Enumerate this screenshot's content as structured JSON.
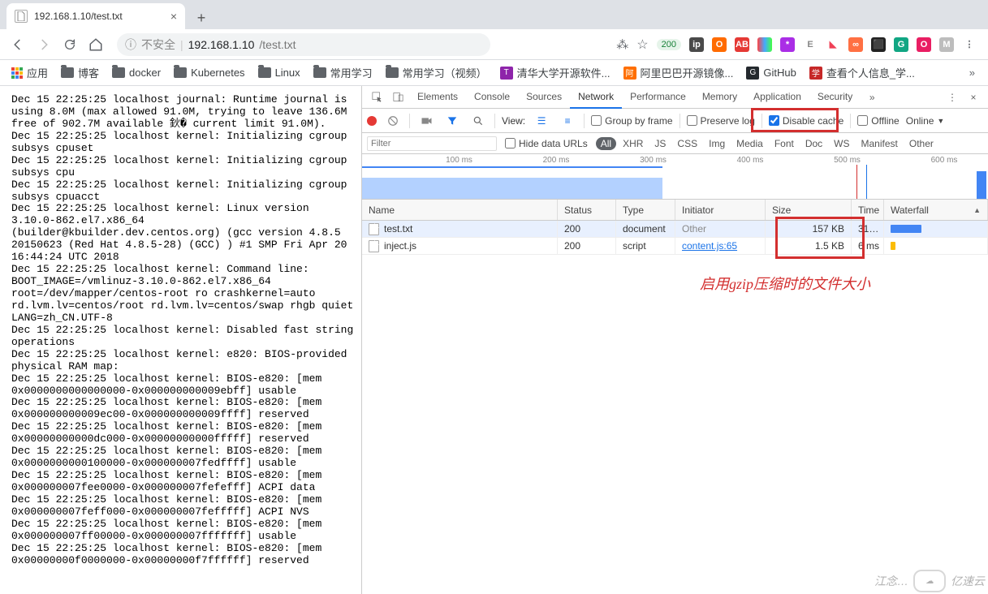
{
  "tab": {
    "title": "192.168.1.10/test.txt"
  },
  "addressbar": {
    "insecure_label": "不安全",
    "host": "192.168.1.10",
    "path": "/test.txt",
    "badge": "200"
  },
  "ext_icons": [
    {
      "name": "translate-icon",
      "bg": "#fff",
      "txt": "文",
      "fg": "#5f6368"
    },
    {
      "name": "star-icon",
      "bg": "#fff",
      "txt": "☆",
      "fg": "#5f6368"
    },
    {
      "name": "ip-icon",
      "bg": "#4a4a4a",
      "txt": "ip"
    },
    {
      "name": "opera-icon",
      "bg": "#ff6b00",
      "txt": "O"
    },
    {
      "name": "adblock-icon",
      "bg": "#e53935",
      "txt": "AB"
    },
    {
      "name": "rainbow-icon",
      "bg": "linear-gradient(90deg,#f44,#4af,#4f4)",
      "txt": ""
    },
    {
      "name": "lastpass-icon",
      "bg": "#aa2ee6",
      "txt": "*"
    },
    {
      "name": "evernote-icon",
      "bg": "#fff",
      "txt": "E",
      "fg": "#888"
    },
    {
      "name": "pocket-icon",
      "bg": "#fff",
      "txt": "◣",
      "fg": "#ef4056"
    },
    {
      "name": "infinity-icon",
      "bg": "#ff7043",
      "txt": "∞"
    },
    {
      "name": "dark-icon",
      "bg": "#222",
      "txt": "⬛"
    },
    {
      "name": "grammarly-icon",
      "bg": "#11a683",
      "txt": "G"
    },
    {
      "name": "onenote-icon",
      "bg": "#e91e63",
      "txt": "O"
    },
    {
      "name": "gray-icon",
      "bg": "#bdbdbd",
      "txt": "M"
    },
    {
      "name": "menu-icon",
      "bg": "#fff",
      "txt": "⋮",
      "fg": "#5f6368"
    }
  ],
  "bookmarks": {
    "apps": "应用",
    "items": [
      {
        "label": "博客",
        "type": "folder"
      },
      {
        "label": "docker",
        "type": "folder"
      },
      {
        "label": "Kubernetes",
        "type": "folder"
      },
      {
        "label": "Linux",
        "type": "folder"
      },
      {
        "label": "常用学习",
        "type": "folder"
      },
      {
        "label": "常用学习（视频）",
        "type": "folder"
      },
      {
        "label": "清华大学开源软件...",
        "type": "fav",
        "bg": "#8e24aa",
        "txt": "T"
      },
      {
        "label": "阿里巴巴开源镜像...",
        "type": "fav",
        "bg": "#ff6f00",
        "txt": "阿"
      },
      {
        "label": "GitHub",
        "type": "fav",
        "bg": "#24292e",
        "txt": "G"
      },
      {
        "label": "查看个人信息_学...",
        "type": "fav",
        "bg": "#c62828",
        "txt": "学"
      }
    ]
  },
  "page_text": "Dec 15 22:25:25 localhost journal: Runtime journal is using 8.0M (max allowed 91.0M, trying to leave 136.6M free of 902.7M available 鈥� current limit 91.0M).\nDec 15 22:25:25 localhost kernel: Initializing cgroup subsys cpuset\nDec 15 22:25:25 localhost kernel: Initializing cgroup subsys cpu\nDec 15 22:25:25 localhost kernel: Initializing cgroup subsys cpuacct\nDec 15 22:25:25 localhost kernel: Linux version 3.10.0-862.el7.x86_64 (builder@kbuilder.dev.centos.org) (gcc version 4.8.5 20150623 (Red Hat 4.8.5-28) (GCC) ) #1 SMP Fri Apr 20 16:44:24 UTC 2018\nDec 15 22:25:25 localhost kernel: Command line: BOOT_IMAGE=/vmlinuz-3.10.0-862.el7.x86_64 root=/dev/mapper/centos-root ro crashkernel=auto rd.lvm.lv=centos/root rd.lvm.lv=centos/swap rhgb quiet LANG=zh_CN.UTF-8\nDec 15 22:25:25 localhost kernel: Disabled fast string operations\nDec 15 22:25:25 localhost kernel: e820: BIOS-provided physical RAM map:\nDec 15 22:25:25 localhost kernel: BIOS-e820: [mem 0x0000000000000000-0x000000000009ebff] usable\nDec 15 22:25:25 localhost kernel: BIOS-e820: [mem 0x000000000009ec00-0x000000000009ffff] reserved\nDec 15 22:25:25 localhost kernel: BIOS-e820: [mem 0x00000000000dc000-0x00000000000fffff] reserved\nDec 15 22:25:25 localhost kernel: BIOS-e820: [mem 0x0000000000100000-0x000000007fedffff] usable\nDec 15 22:25:25 localhost kernel: BIOS-e820: [mem 0x000000007fee0000-0x000000007fefefff] ACPI data\nDec 15 22:25:25 localhost kernel: BIOS-e820: [mem 0x000000007feff000-0x000000007fefffff] ACPI NVS\nDec 15 22:25:25 localhost kernel: BIOS-e820: [mem 0x000000007ff00000-0x000000007fffffff] usable\nDec 15 22:25:25 localhost kernel: BIOS-e820: [mem 0x00000000f0000000-0x00000000f7ffffff] reserved",
  "devtools": {
    "tabs": [
      "Elements",
      "Console",
      "Sources",
      "Network",
      "Performance",
      "Memory",
      "Application",
      "Security"
    ],
    "active_tab": "Network",
    "toolbar": {
      "view_label": "View:",
      "group_by_frame": "Group by frame",
      "preserve_log": "Preserve log",
      "disable_cache": "Disable cache",
      "disable_cache_checked": true,
      "offline": "Offline",
      "online": "Online"
    },
    "filters": {
      "placeholder": "Filter",
      "hide_data_urls": "Hide data URLs",
      "types": [
        "All",
        "XHR",
        "JS",
        "CSS",
        "Img",
        "Media",
        "Font",
        "Doc",
        "WS",
        "Manifest",
        "Other"
      ],
      "active_type": "All"
    },
    "timeline_ticks": [
      "100 ms",
      "200 ms",
      "300 ms",
      "400 ms",
      "500 ms",
      "600 ms"
    ],
    "columns": [
      "Name",
      "Status",
      "Type",
      "Initiator",
      "Size",
      "Time",
      "Waterfall"
    ],
    "rows": [
      {
        "name": "test.txt",
        "status": "200",
        "type": "document",
        "initiator": "Other",
        "initiator_dim": true,
        "size": "157 KB",
        "time": "31…",
        "selected": true,
        "wf_color": "#4285f4",
        "wf_w": 38,
        "wf_x": 0
      },
      {
        "name": "inject.js",
        "status": "200",
        "type": "script",
        "initiator": "content.js:65",
        "initiator_dim": false,
        "size": "1.5 KB",
        "time": "6 ms",
        "selected": false,
        "wf_color": "#fbbc04",
        "wf_w": 6,
        "wf_x": 0
      }
    ]
  },
  "annotation_text": "启用gzip压缩时的文件大小",
  "watermark": {
    "text": "江念…",
    "brand": "亿速云"
  }
}
